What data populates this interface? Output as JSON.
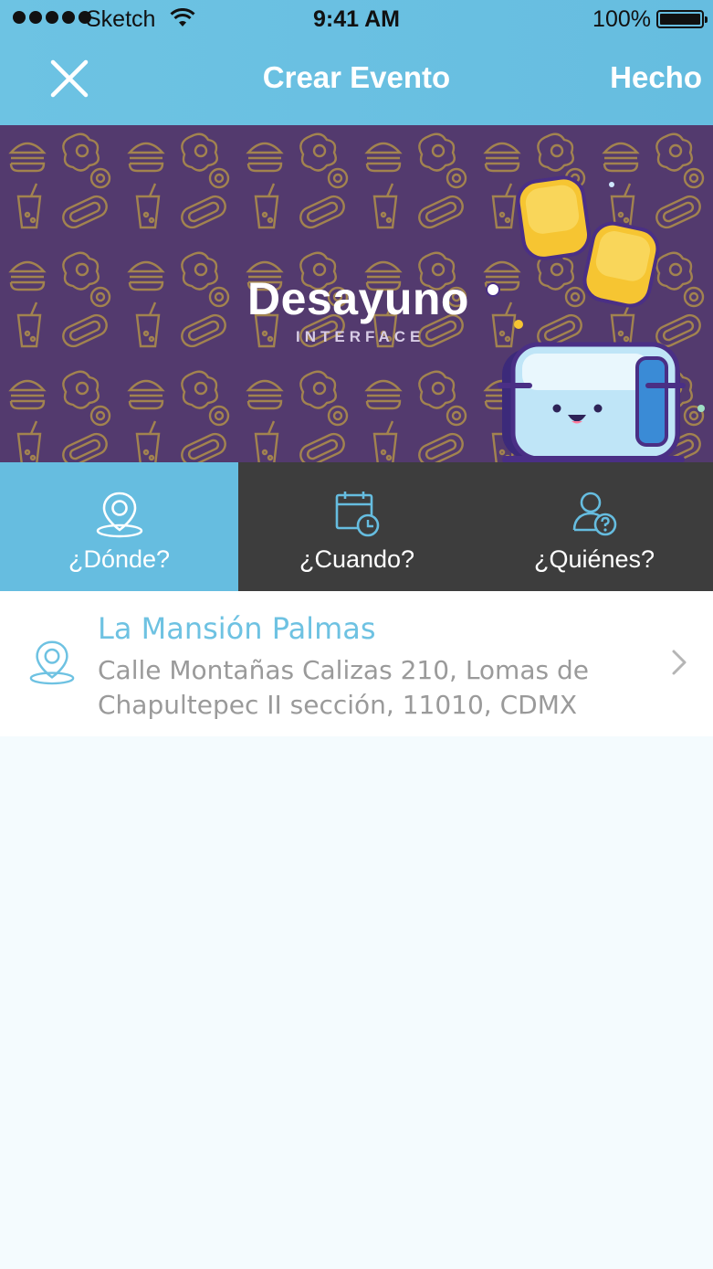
{
  "status_bar": {
    "carrier": "Sketch",
    "time": "9:41 AM",
    "battery": "100%"
  },
  "nav": {
    "title": "Crear Evento",
    "done_label": "Hecho",
    "close_icon": "close-icon"
  },
  "hero": {
    "title": "Desayuno",
    "subtitle": "INTERFACE",
    "background_color": "#533a6e"
  },
  "tabs": [
    {
      "label": "¿Dónde?",
      "icon": "location-pin-icon",
      "active": true
    },
    {
      "label": "¿Cuando?",
      "icon": "calendar-clock-icon",
      "active": false
    },
    {
      "label": "¿Quiénes?",
      "icon": "user-question-icon",
      "active": false
    }
  ],
  "location": {
    "name": "La Mansión Palmas",
    "address": "Calle Montañas Calizas 210, Lomas de Chapultepec II sección, 11010, CDMX"
  },
  "colors": {
    "accent": "#66bde0",
    "dark_tab": "#3d3d3d",
    "background": "#f4fbfe"
  }
}
